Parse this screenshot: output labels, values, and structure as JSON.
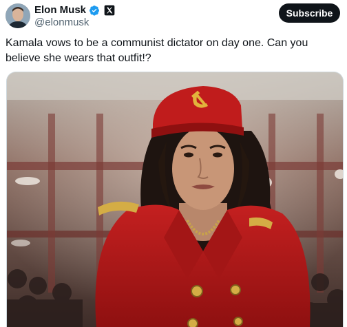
{
  "author": {
    "display_name": "Elon Musk",
    "handle": "@elonmusk",
    "verified_icon": "verified-badge-icon",
    "platform_icon": "x-logo-icon"
  },
  "subscribe_label": "Subscribe",
  "tweet": {
    "text": "Kamala vows to be a communist dictator on day one. Can you believe she wears that outfit!?"
  },
  "media": {
    "icon": "hammer-and-sickle-icon"
  },
  "colors": {
    "text": "#0f1419",
    "secondary": "#536471",
    "verified": "#1d9bf0",
    "uniform_red": "#b81c1c"
  }
}
